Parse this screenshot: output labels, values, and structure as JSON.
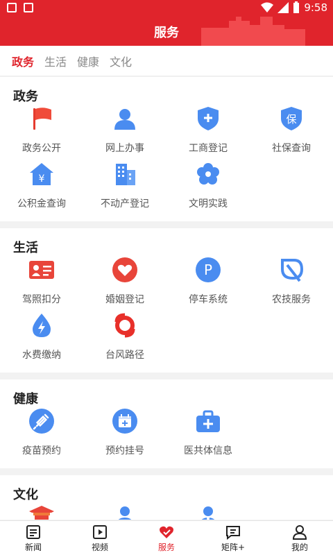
{
  "status": {
    "time": "9:58"
  },
  "header": {
    "title": "服务"
  },
  "tabs": [
    {
      "label": "政务",
      "active": true
    },
    {
      "label": "生活",
      "active": false
    },
    {
      "label": "健康",
      "active": false
    },
    {
      "label": "文化",
      "active": false
    }
  ],
  "sections": {
    "gov": {
      "title": "政务",
      "items": [
        {
          "label": "政务公开",
          "icon": "flag-icon"
        },
        {
          "label": "网上办事",
          "icon": "user-icon"
        },
        {
          "label": "工商登记",
          "icon": "shield-plus-icon"
        },
        {
          "label": "社保查询",
          "icon": "shield-bao-icon"
        },
        {
          "label": "公积金查询",
          "icon": "house-yen-icon"
        },
        {
          "label": "不动产登记",
          "icon": "building-icon"
        },
        {
          "label": "文明实践",
          "icon": "flower-icon"
        }
      ]
    },
    "life": {
      "title": "生活",
      "items": [
        {
          "label": "驾照扣分",
          "icon": "id-card-icon"
        },
        {
          "label": "婚姻登记",
          "icon": "heart-icon"
        },
        {
          "label": "停车系统",
          "icon": "parking-icon"
        },
        {
          "label": "农技服务",
          "icon": "leaf-icon"
        },
        {
          "label": "水费缴纳",
          "icon": "water-drop-icon"
        },
        {
          "label": "台风路径",
          "icon": "typhoon-icon"
        }
      ]
    },
    "health": {
      "title": "健康",
      "items": [
        {
          "label": "疫苗预约",
          "icon": "syringe-icon"
        },
        {
          "label": "预约挂号",
          "icon": "calendar-plus-icon"
        },
        {
          "label": "医共体信息",
          "icon": "medical-kit-icon"
        }
      ]
    },
    "culture": {
      "title": "文化",
      "items": [
        {
          "label": "",
          "icon": "pavilion-icon"
        },
        {
          "label": "",
          "icon": "person-icon"
        },
        {
          "label": "",
          "icon": "official-icon"
        }
      ]
    }
  },
  "bottom_nav": [
    {
      "label": "新闻",
      "icon": "news-icon",
      "active": false
    },
    {
      "label": "视频",
      "icon": "video-icon",
      "active": false
    },
    {
      "label": "服务",
      "icon": "service-heart-icon",
      "active": true
    },
    {
      "label": "矩阵+",
      "icon": "chat-icon",
      "active": false
    },
    {
      "label": "我的",
      "icon": "profile-icon",
      "active": false
    }
  ],
  "colors": {
    "brand": "#e0242c",
    "icon_blue": "#4a8cf0"
  }
}
